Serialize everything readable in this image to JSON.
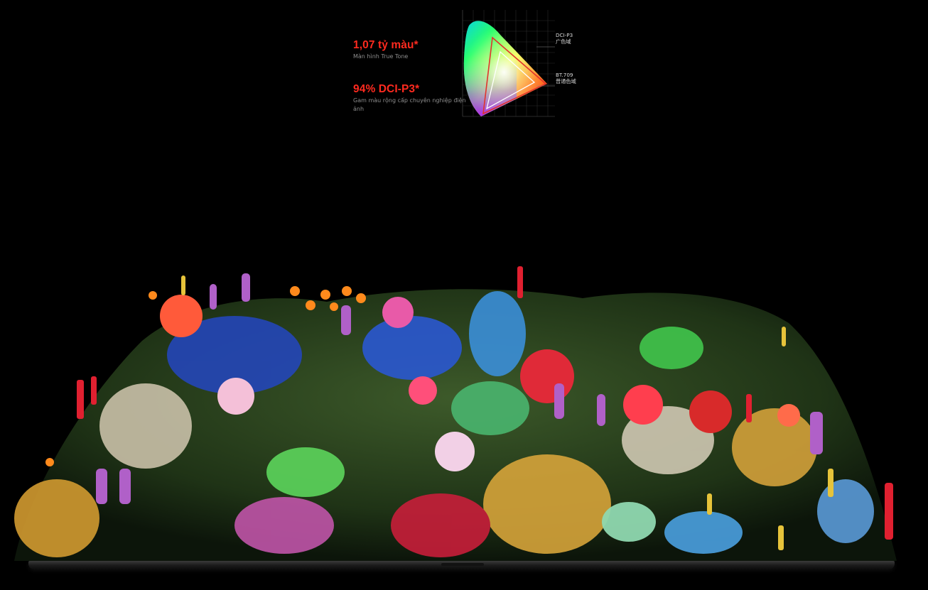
{
  "stats": [
    {
      "headline": "1,07 tỷ màu*",
      "caption": "Màn hình True Tone"
    },
    {
      "headline": "94% DCI-P3*",
      "caption": "Gam màu rộng cấp chuyên nghiệp điện ảnh"
    }
  ],
  "gamut_diagram": {
    "dci_label_line1": "DCI-P3",
    "dci_label_line2": "广色域",
    "bt_label_line1": "BT.709",
    "bt_label_line2": "普通色域",
    "dci_color": "#e0342c",
    "bt_color": "#ffffff"
  },
  "colors": {
    "accent": "#ff2a1f",
    "background": "#000000",
    "caption": "#8e8e8e"
  }
}
